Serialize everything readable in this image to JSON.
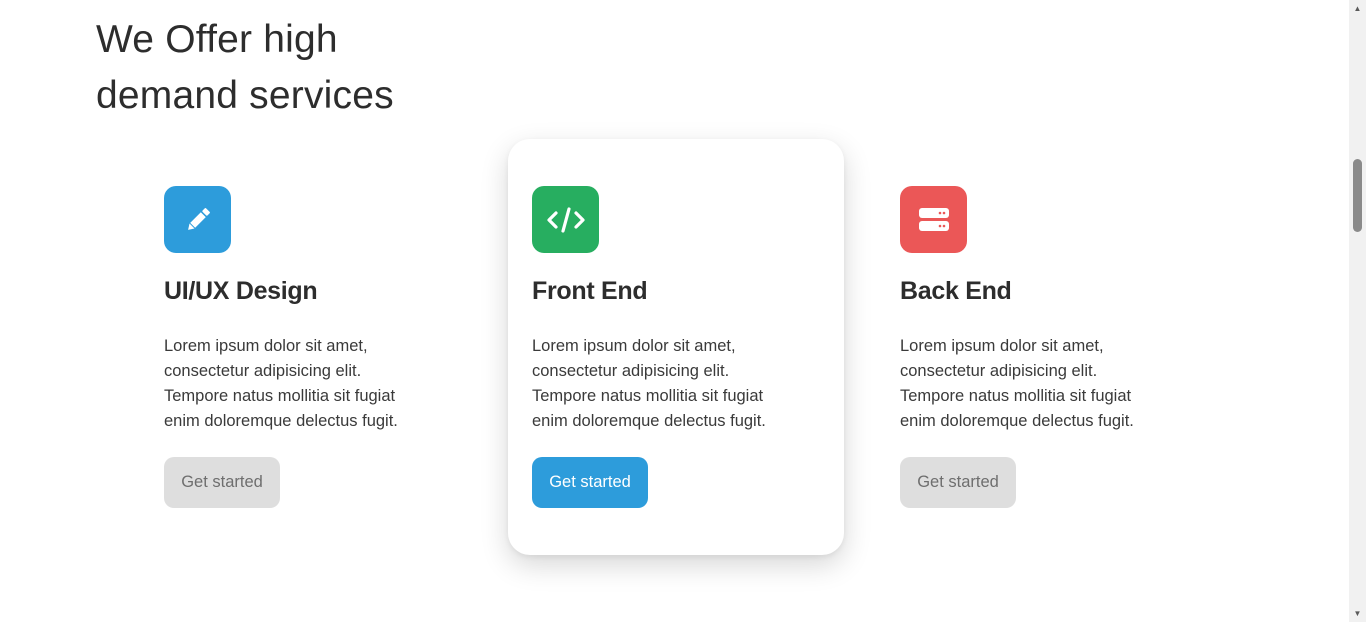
{
  "heading": {
    "line1": "We Offer high",
    "line2": "demand services"
  },
  "cards": [
    {
      "title": "UI/UX Design",
      "icon": "pencil-icon",
      "icon_color": "#2d9cdb",
      "text": [
        "Lorem ipsum dolor sit amet,",
        "consectetur adipisicing elit.",
        "Tempore natus mollitia sit fugiat",
        "enim doloremque delectus fugit."
      ],
      "button": "Get started"
    },
    {
      "title": "Front End",
      "icon": "code-icon",
      "icon_color": "#27ae60",
      "text": [
        "Lorem ipsum dolor sit amet,",
        "consectetur adipisicing elit.",
        "Tempore natus mollitia sit fugiat",
        "enim doloremque delectus fugit."
      ],
      "button": "Get started"
    },
    {
      "title": "Back End",
      "icon": "server-icon",
      "icon_color": "#eb5757",
      "text": [
        "Lorem ipsum dolor sit amet,",
        "consectetur adipisicing elit.",
        "Tempore natus mollitia sit fugiat",
        "enim doloremque delectus fugit."
      ],
      "button": "Get started"
    }
  ],
  "colors": {
    "primary_button": "#2d9cdb",
    "muted_button": "#dedede"
  }
}
